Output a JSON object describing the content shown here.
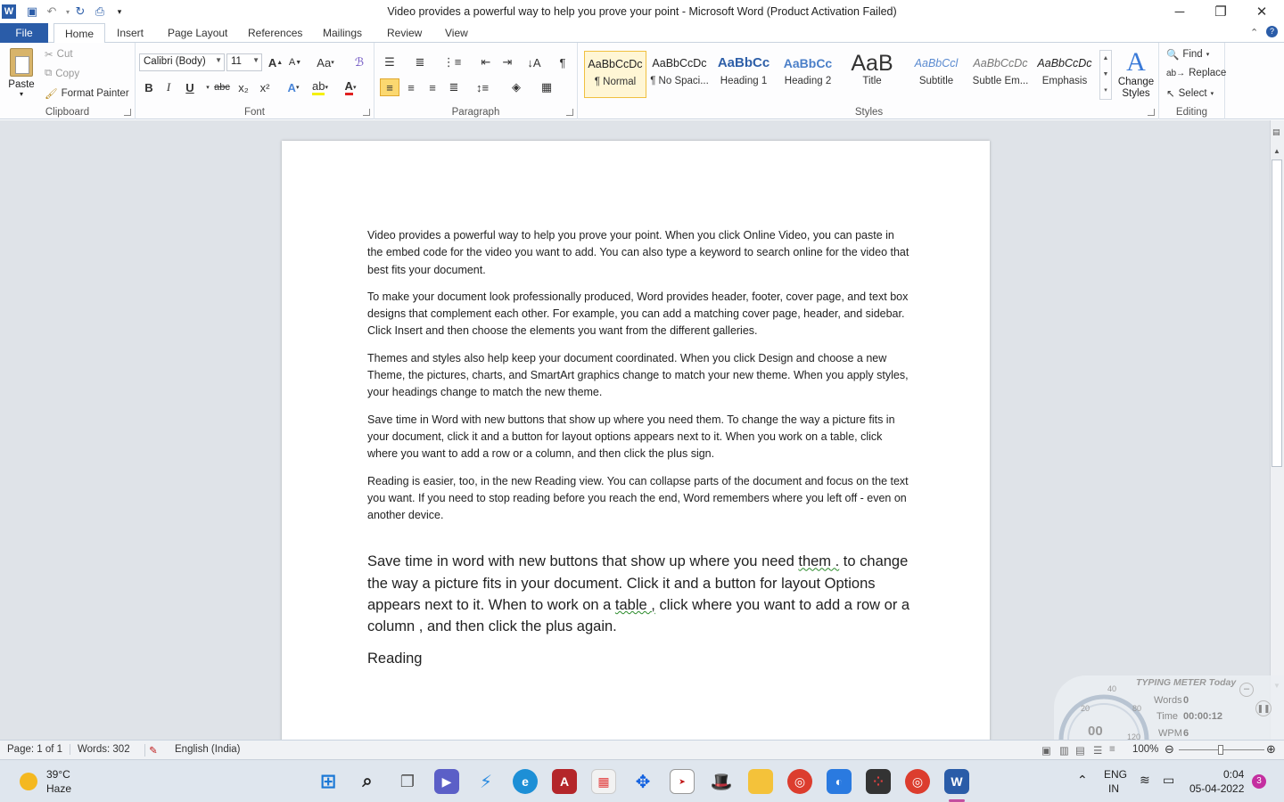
{
  "window": {
    "title": "Video provides a powerful way to help you prove your point  -  Microsoft Word (Product Activation Failed)",
    "controls": {
      "minimize": "─",
      "restore": "❐",
      "close": "✕"
    }
  },
  "tabs": [
    "File",
    "Home",
    "Insert",
    "Page Layout",
    "References",
    "Mailings",
    "Review",
    "View"
  ],
  "clipboard": {
    "paste": "Paste",
    "cut": "Cut",
    "copy": "Copy",
    "format_painter": "Format Painter",
    "label": "Clipboard"
  },
  "font": {
    "name": "Calibri (Body)",
    "size": "11",
    "label": "Font",
    "grow": "A",
    "shrink": "A",
    "case": "Aa",
    "bold": "B",
    "italic": "I",
    "underline": "U",
    "strike": "abc",
    "subscript": "x₂",
    "superscript": "x²"
  },
  "paragraph": {
    "label": "Paragraph",
    "pilcrow": "¶"
  },
  "styles": {
    "label": "Styles",
    "items": [
      {
        "sample": "AaBbCcDc",
        "name": "¶ Normal"
      },
      {
        "sample": "AaBbCcDc",
        "name": "¶ No Spaci..."
      },
      {
        "sample": "AaBbCc",
        "name": "Heading 1"
      },
      {
        "sample": "AaBbCc",
        "name": "Heading 2"
      },
      {
        "sample": "AaB",
        "name": "Title"
      },
      {
        "sample": "AaBbCcl",
        "name": "Subtitle"
      },
      {
        "sample": "AaBbCcDc",
        "name": "Subtle Em..."
      },
      {
        "sample": "AaBbCcDc",
        "name": "Emphasis"
      }
    ],
    "change_styles": "Change Styles"
  },
  "editing": {
    "label": "Editing",
    "find": "Find",
    "replace": "Replace",
    "select": "Select"
  },
  "document": {
    "paragraphs": [
      "Video provides a powerful way to help you prove your point. When you click Online Video, you can paste in the embed code for the video you want to add. You can also type a keyword to search online for the video that best fits your document.",
      "To make your document look professionally produced, Word provides header, footer, cover page, and text box designs that complement each other. For example, you can add a matching cover page, header, and sidebar. Click Insert and then choose the elements you want from the different galleries.",
      "Themes and styles also help keep your document coordinated. When you click Design and choose a new Theme, the pictures, charts, and SmartArt graphics change to match your new theme. When you apply styles, your headings change to match the new theme.",
      "Save time in Word with new buttons that show up where you need them. To change the way a picture fits in your document, click it and a button for layout options appears next to it.  When you work on a table, click where you want to add a row or a column, and then click  the plus sign.",
      "Reading is  easier, too, in the new Reading view. You can collapse parts of the document and focus on the text you want. If you need to stop reading before you reach the end, Word remembers where you left off - even on another device."
    ],
    "typed_part1": "Save time in word with new buttons that show up where you need ",
    "typed_err1": "them .",
    "typed_part2": " to change the way a picture fits in your document. Click it and a button for layout Options appears next to it. When to work on a ",
    "typed_err2": "table ,",
    "typed_part3": " click where you want to add a row or a column , and then click the plus again.",
    "typed_last": "Reading"
  },
  "status": {
    "page": "Page: 1 of 1",
    "words": "Words: 302",
    "language": "English (India)",
    "zoom": "100%"
  },
  "typing_meter": {
    "title": "TYPING METER Today",
    "words_label": "Words",
    "words": "0",
    "time_label": "Time",
    "time": "00:00:12",
    "wpm_label": "WPM",
    "wpm": "6",
    "gauge": "00",
    "tick_20": "20",
    "tick_40": "40",
    "tick_80": "80",
    "tick_120": "120"
  },
  "taskbar": {
    "weather_temp": "39°C",
    "weather_desc": "Haze",
    "lang1": "ENG",
    "lang2": "IN",
    "time": "0:04",
    "date": "05-04-2022",
    "notif_count": "3"
  }
}
